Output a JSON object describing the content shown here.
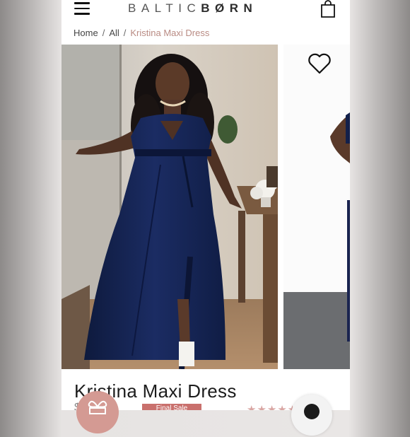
{
  "header": {
    "logo_light": "BALTIC",
    "logo_bold": "BØRN",
    "menu_icon": "hamburger-menu-icon",
    "cart_icon": "shopping-bag-icon"
  },
  "breadcrumb": {
    "home": "Home",
    "separator": "/",
    "all": "All",
    "current": "Kristina Maxi Dress"
  },
  "gallery": {
    "favorite_icon": "heart-outline-icon",
    "main_image": "model-in-navy-maxi-dress-photo",
    "next_image": "second-product-photo-partial"
  },
  "product": {
    "title": "Kristina Maxi Dress",
    "price_fragment": "$ 5",
    "sale_badge": "Final Sale",
    "rating_stars": "★★★★★"
  },
  "floating": {
    "gift_icon": "gift-icon",
    "chat_icon": "chat-icon"
  },
  "colors": {
    "accent_pink": "#b98b83",
    "dress_navy": "#15244f",
    "sale_red": "#c9706d"
  }
}
